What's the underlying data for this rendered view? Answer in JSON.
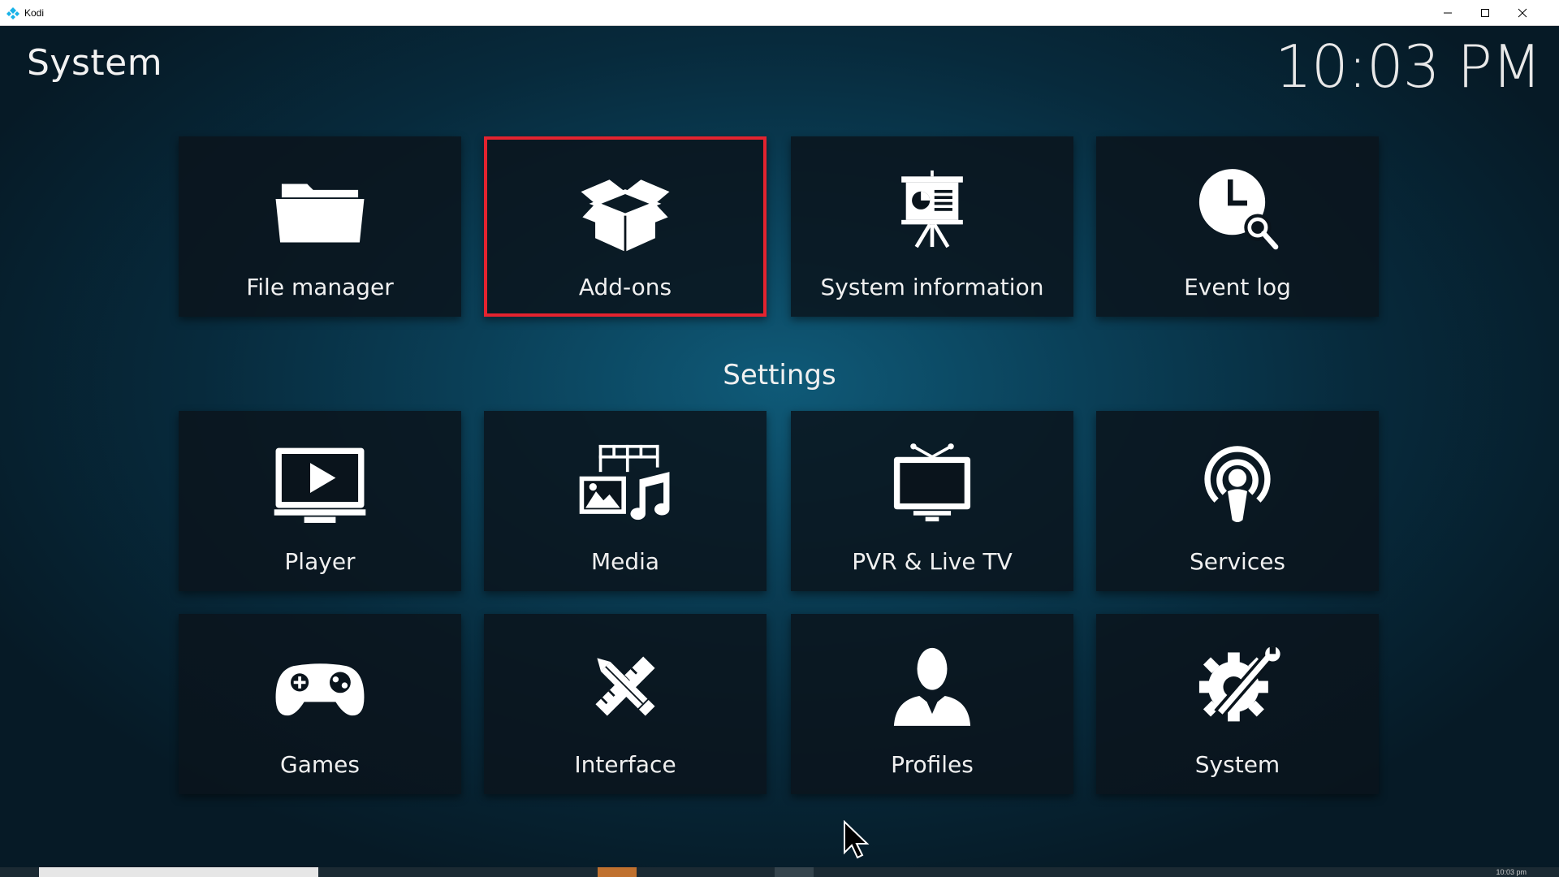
{
  "window": {
    "title": "Kodi"
  },
  "header": {
    "title": "System",
    "clock": "10:03 PM"
  },
  "top_tiles": [
    {
      "label": "File manager",
      "icon": "folder-icon"
    },
    {
      "label": "Add-ons",
      "icon": "box-icon",
      "focused": true
    },
    {
      "label": "System information",
      "icon": "presentation-icon"
    },
    {
      "label": "Event log",
      "icon": "clock-search-icon"
    }
  ],
  "settings": {
    "title": "Settings",
    "tiles": [
      {
        "label": "Player",
        "icon": "monitor-play-icon"
      },
      {
        "label": "Media",
        "icon": "media-icon"
      },
      {
        "label": "PVR & Live TV",
        "icon": "tv-antenna-icon"
      },
      {
        "label": "Services",
        "icon": "podcast-icon"
      },
      {
        "label": "Games",
        "icon": "gamepad-icon"
      },
      {
        "label": "Interface",
        "icon": "pencil-ruler-icon"
      },
      {
        "label": "Profiles",
        "icon": "person-icon"
      },
      {
        "label": "System",
        "icon": "gear-wrench-icon"
      }
    ]
  },
  "taskbar": {
    "clock": "10:03 pm"
  },
  "colors": {
    "focus": "#e3232f",
    "tile_bg": "#0a141c",
    "text": "#f0f0f0"
  }
}
